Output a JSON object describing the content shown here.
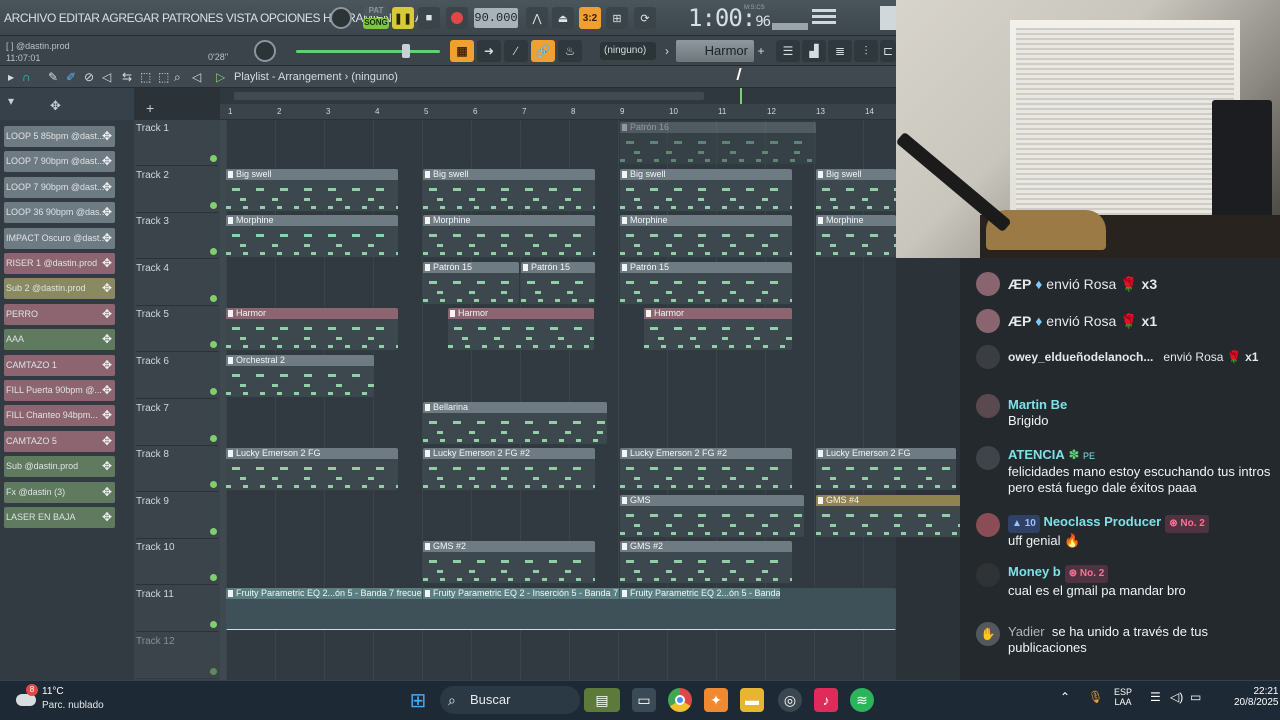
{
  "menu": {
    "items": "ARCHIVO EDITAR AGREGAR PATRONES VISTA OPCIONES HERRAMIENTAS AYU"
  },
  "transport": {
    "pat_label": "PAT",
    "song_label": "SONG",
    "tempo": "90.000",
    "time_main": "1:00",
    "time_sub": "96",
    "time_unit": "M:S:CS"
  },
  "hint": {
    "line1": "[ ] @dastin.prod",
    "line2": "11:07:01",
    "elapsed": "0'28''"
  },
  "toolbar": {
    "pattern_selector": "(ninguno)",
    "plugin_name": "Harmor",
    "plus": "+"
  },
  "playlist": {
    "title": "Playlist - Arrangement",
    "pattern": "(ninguno)"
  },
  "channels": [
    {
      "label": "LOOP 5 85bpm @dast...",
      "color": "#6f7b82"
    },
    {
      "label": "LOOP 7 90bpm @dast...",
      "color": "#6f7b82"
    },
    {
      "label": "LOOP 7 90bpm @dast...",
      "color": "#6f7b82"
    },
    {
      "label": "LOOP 36 90bpm @das...",
      "color": "#6f7b82"
    },
    {
      "label": "IMPACT Oscuro @dast...",
      "color": "#6f7b82"
    },
    {
      "label": "RISER 1 @dastin.prod",
      "color": "#8d6570"
    },
    {
      "label": "Sub 2 @dastin.prod",
      "color": "#8a8a60"
    },
    {
      "label": "PERRO",
      "color": "#8d6570"
    },
    {
      "label": "AAA",
      "color": "#5f7a5e"
    },
    {
      "label": "CAMTAZO 1",
      "color": "#8d6570"
    },
    {
      "label": "FILL Puerta 90bpm @...",
      "color": "#8d6570"
    },
    {
      "label": "FILL Chanteo 94bpm...",
      "color": "#8d6570"
    },
    {
      "label": "CAMTAZO 5",
      "color": "#8d6570"
    },
    {
      "label": "Sub @dastin.prod",
      "color": "#5f7a5e"
    },
    {
      "label": "Fx @dastin (3)",
      "color": "#5f7a5e"
    },
    {
      "label": "LASER EN BAJA",
      "color": "#5f7a5e"
    }
  ],
  "ruler": [
    "1",
    "2",
    "3",
    "4",
    "5",
    "6",
    "7",
    "8",
    "9",
    "10",
    "11",
    "12",
    "13",
    "14"
  ],
  "tracks": [
    "Track 1",
    "Track 2",
    "Track 3",
    "Track 4",
    "Track 5",
    "Track 6",
    "Track 7",
    "Track 8",
    "Track 9",
    "Track 10",
    "Track 11",
    "Track 12"
  ],
  "clips": {
    "patron16": "Patrón 16",
    "bigswell": "Big swell",
    "morphine": "Morphine",
    "patron15": "Patrón 15",
    "harmor": "Harmor",
    "orchestral": "Orchestral 2",
    "bellarina": "Bellarina",
    "lucky1": "Lucky Emerson 2 FG",
    "lucky2": "Lucky Emerson 2 FG #2",
    "gms": "GMS",
    "gms4": "GMS #4",
    "gms2": "GMS #2",
    "eq1": "Fruity Parametric EQ 2...ón 5 - Banda 7 frecuencia",
    "eq2": "Fruity Parametric EQ 2 - Inserción 5 - Banda 7 frecuencia",
    "eq3": "Fruity Parametric EQ 2...ón 5 - Banda 7 frecuencia",
    "bella_ghost": "Bella #",
    "lucky_ghost": "Lucky Emerson 2 FG #2",
    "gms_ghost": "GMS #2"
  },
  "chat": {
    "gifts": [
      {
        "user": "ÆP",
        "action": "envió Rosa",
        "count": "x3"
      },
      {
        "user": "ÆP",
        "action": "envió Rosa",
        "count": "x1"
      },
      {
        "user": "owey_eldueñodelanoch...",
        "action": "envió Rosa",
        "count": "x1"
      }
    ],
    "messages": [
      {
        "user": "Martin Be",
        "text": "Brigido"
      },
      {
        "user": "ATENCIA",
        "badge": "PE",
        "text": "felicidades mano estoy escuchando tus intros pero está fuego dale éxitos paaa"
      },
      {
        "user": "Neoclass Producer",
        "level": "10",
        "rank": "No. 2",
        "text": "uff genial 🔥"
      },
      {
        "user": "Money b",
        "rank": "No. 2",
        "text": "cual es el gmail pa mandar bro"
      }
    ],
    "join": {
      "user": "Yadier",
      "text": "se ha unido a través de tus publicaciones"
    }
  },
  "taskbar": {
    "temp": "11°C",
    "weather": "Parc. nublado",
    "weather_badge": "8",
    "search": "Buscar",
    "lang1": "ESP",
    "lang2": "LAA",
    "time": "22:21",
    "date": "20/8/2025"
  },
  "colors": {
    "accent_orange": "#f0a030",
    "note_green": "#8fd0a4",
    "record_red": "#e04848"
  }
}
